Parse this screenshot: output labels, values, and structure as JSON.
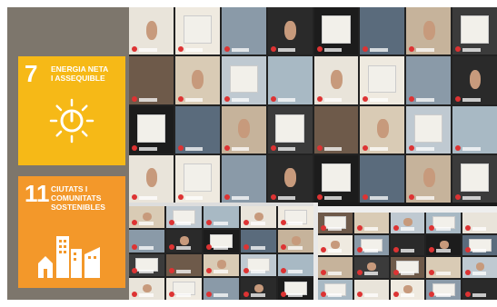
{
  "sdg_panel": {
    "goal7": {
      "number": "7",
      "title": "ENERGIA NETA\nI ASSEQUIBLE",
      "color": "#f6b917",
      "icon": "sun-power-icon"
    },
    "goal11": {
      "number": "11",
      "title": "CIUTATS I\nCOMUNITATS\nSOSTENIBLES",
      "color": "#f3982a",
      "icon": "city-buildings-icon"
    }
  },
  "video_grid": {
    "top_tiles": 32,
    "bottom_left_tiles": 20,
    "bottom_right_tiles": 20,
    "colors": [
      "#5a6b7c",
      "#e9e4da",
      "#3b3b3b",
      "#8a9aa8",
      "#d9cbb5",
      "#1c1c1c",
      "#a8b9c4",
      "#c6b39b",
      "#efeae0",
      "#6e5a4a",
      "#2a2a2a",
      "#bfc9d1"
    ]
  }
}
